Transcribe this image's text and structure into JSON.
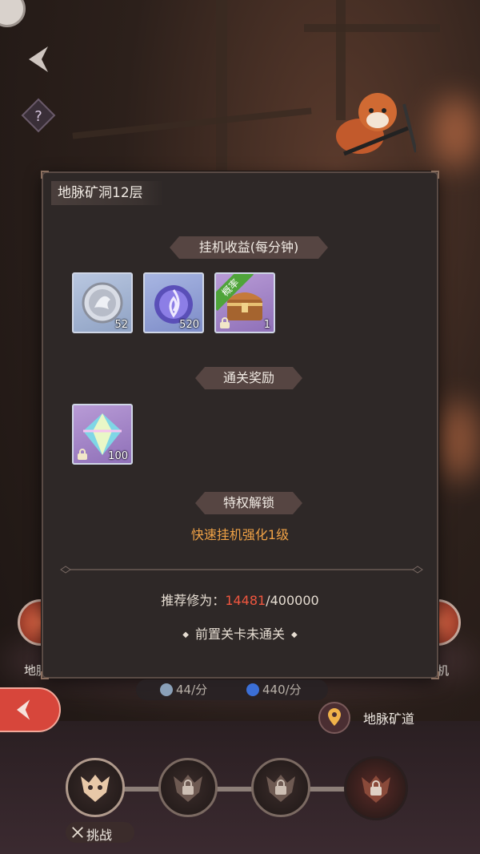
{
  "panel": {
    "title": "地脉矿洞12层",
    "idle_section_label": "挂机收益(每分钟)",
    "idle_items": [
      {
        "icon": "silver-dragon-coin-icon",
        "count": "52"
      },
      {
        "icon": "spirit-orb-icon",
        "count": "520"
      },
      {
        "icon": "treasure-chest-icon",
        "count": "1",
        "badge": "概率",
        "locked": true
      }
    ],
    "clear_section_label": "通关奖励",
    "clear_items": [
      {
        "icon": "rainbow-crystal-icon",
        "count": "100",
        "locked": true
      }
    ],
    "privilege_section_label": "特权解锁",
    "privilege_text": "快速挂机强化1级",
    "recommend_label": "推荐修为：",
    "recommend_current": "14481",
    "recommend_required": "/400000",
    "prereq_text": "前置关卡未通关"
  },
  "bottom": {
    "left_side_label": "地脉",
    "right_side_label": "机",
    "rate_1": "44/分",
    "rate_2": "440/分",
    "location_label": "地脉矿道",
    "challenge_label": "挑战"
  },
  "colors": {
    "accent_orange": "#f0a246",
    "recommend_red": "#f0563f",
    "probability_green": "#4fa43a"
  }
}
